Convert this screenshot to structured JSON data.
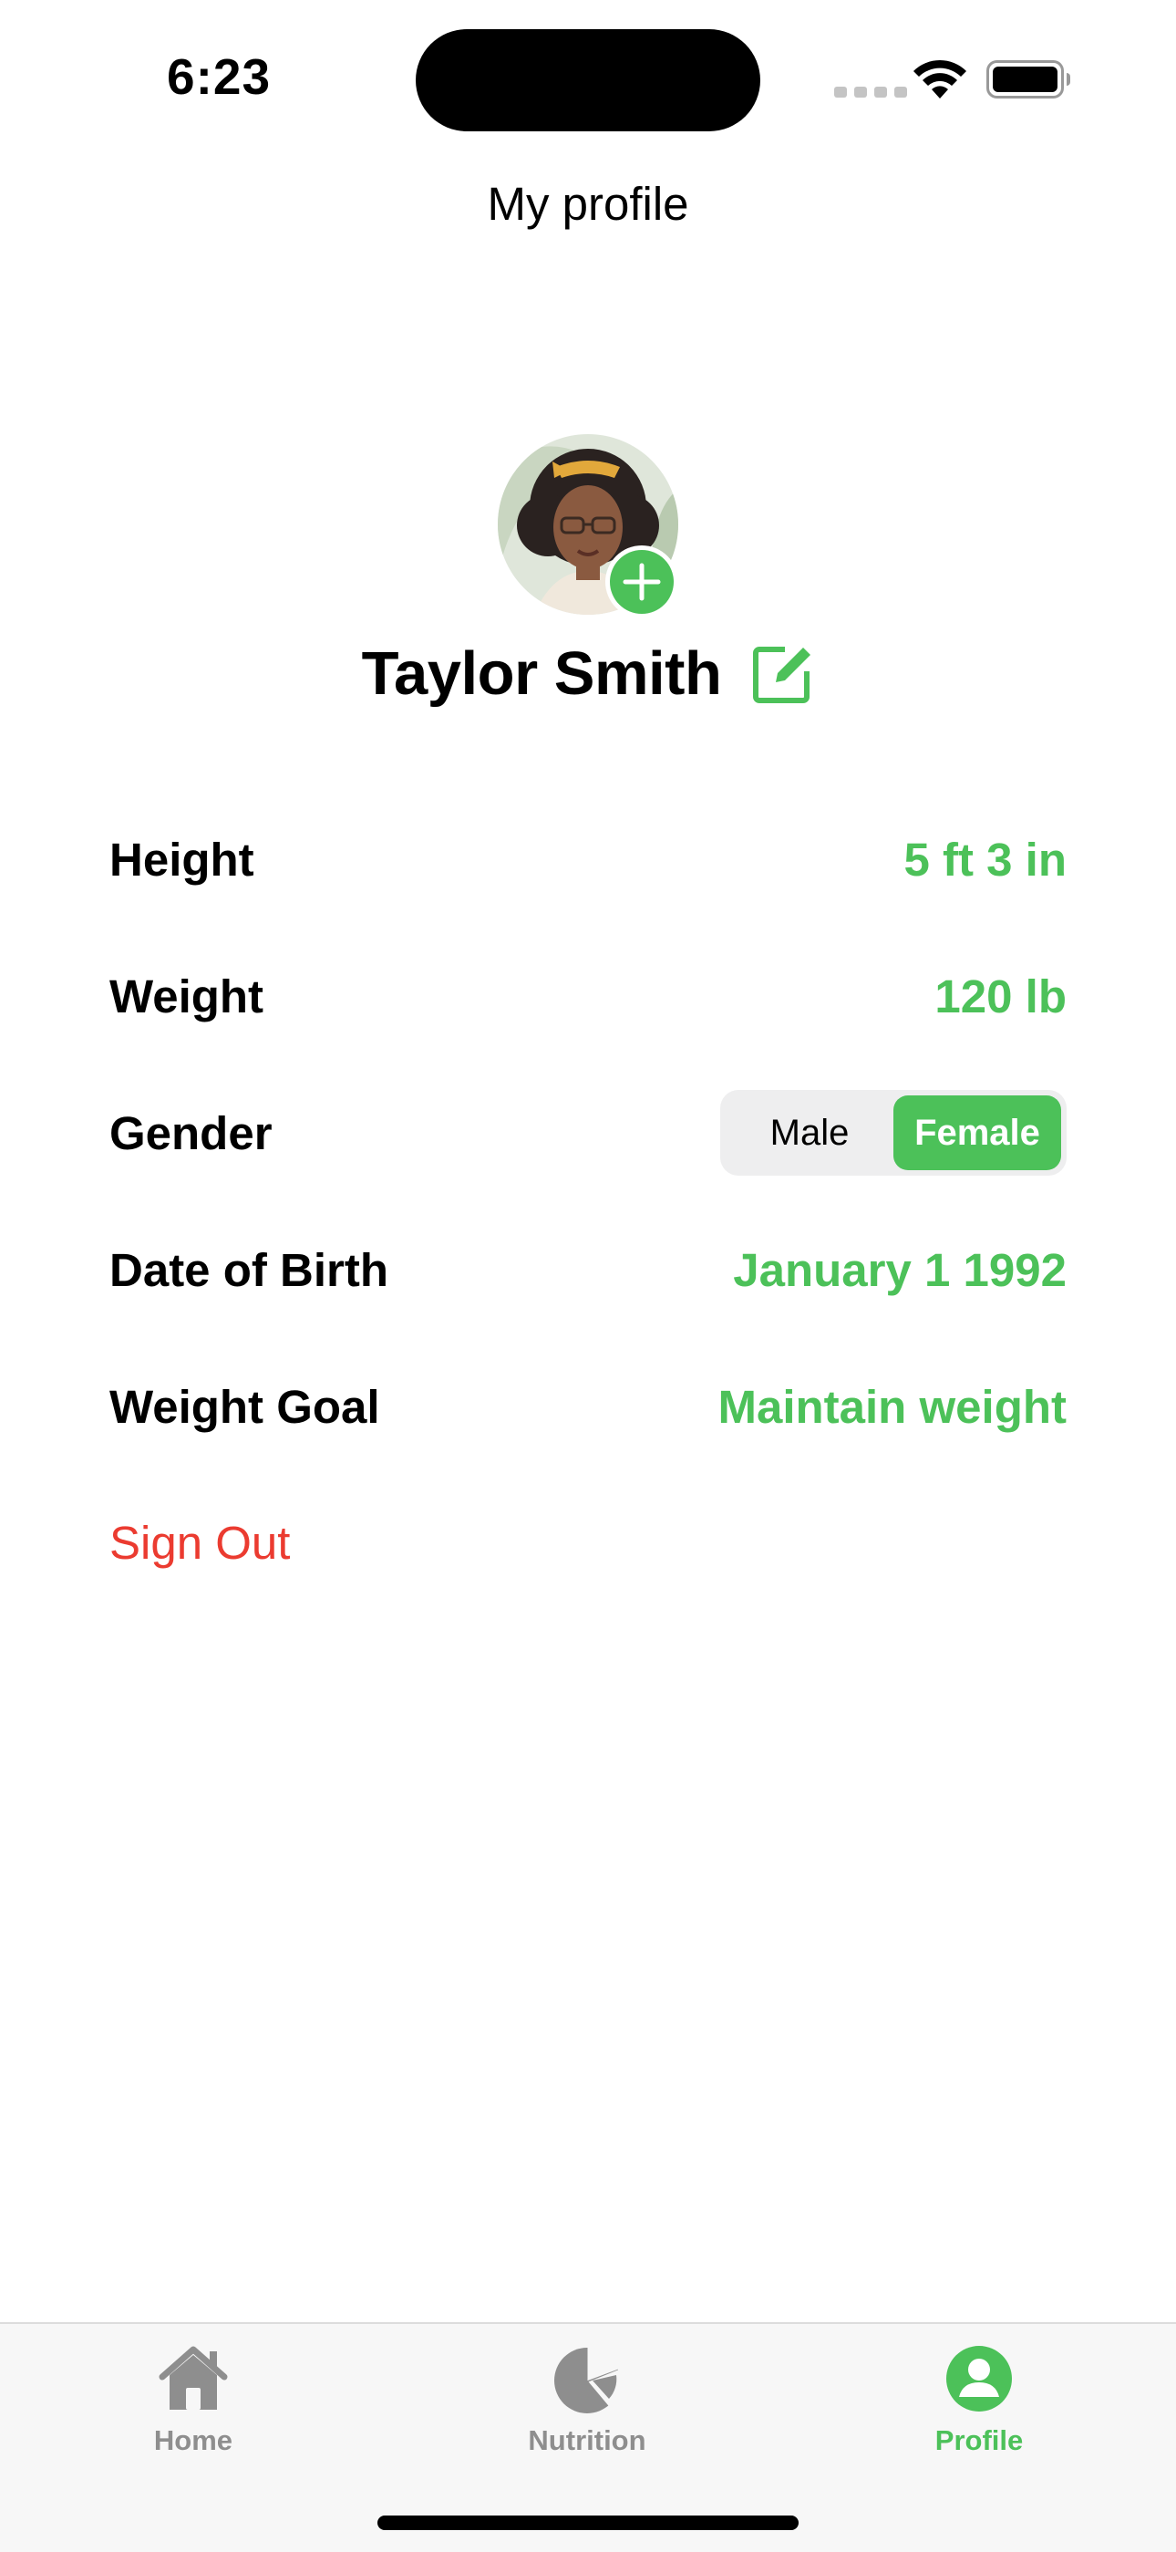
{
  "status_bar": {
    "time": "6:23",
    "icons": [
      "signal-icon",
      "wifi-icon",
      "battery-icon"
    ]
  },
  "header": {
    "title": "My profile"
  },
  "profile": {
    "name": "Taylor Smith",
    "avatar_icon": "avatar",
    "add_photo_icon": "plus-icon",
    "edit_icon": "edit-icon"
  },
  "fields": {
    "height": {
      "label": "Height",
      "value": "5 ft 3 in"
    },
    "weight": {
      "label": "Weight",
      "value": "120 lb"
    },
    "gender": {
      "label": "Gender",
      "options": [
        "Male",
        "Female"
      ],
      "selected": "Female"
    },
    "dob": {
      "label": "Date of Birth",
      "value": "January 1 1992"
    },
    "goal": {
      "label": "Weight Goal",
      "value": "Maintain weight"
    }
  },
  "actions": {
    "sign_out": "Sign Out"
  },
  "tab_bar": {
    "tabs": [
      {
        "label": "Home",
        "icon": "home-icon",
        "active": false
      },
      {
        "label": "Nutrition",
        "icon": "pie-chart-icon",
        "active": false
      },
      {
        "label": "Profile",
        "icon": "person-circle-icon",
        "active": true
      }
    ]
  },
  "colors": {
    "accent": "#4cc159",
    "destructive": "#eb3b30",
    "inactive_tab": "#8e8e8e",
    "tab_bar_bg": "#f7f7f7"
  }
}
